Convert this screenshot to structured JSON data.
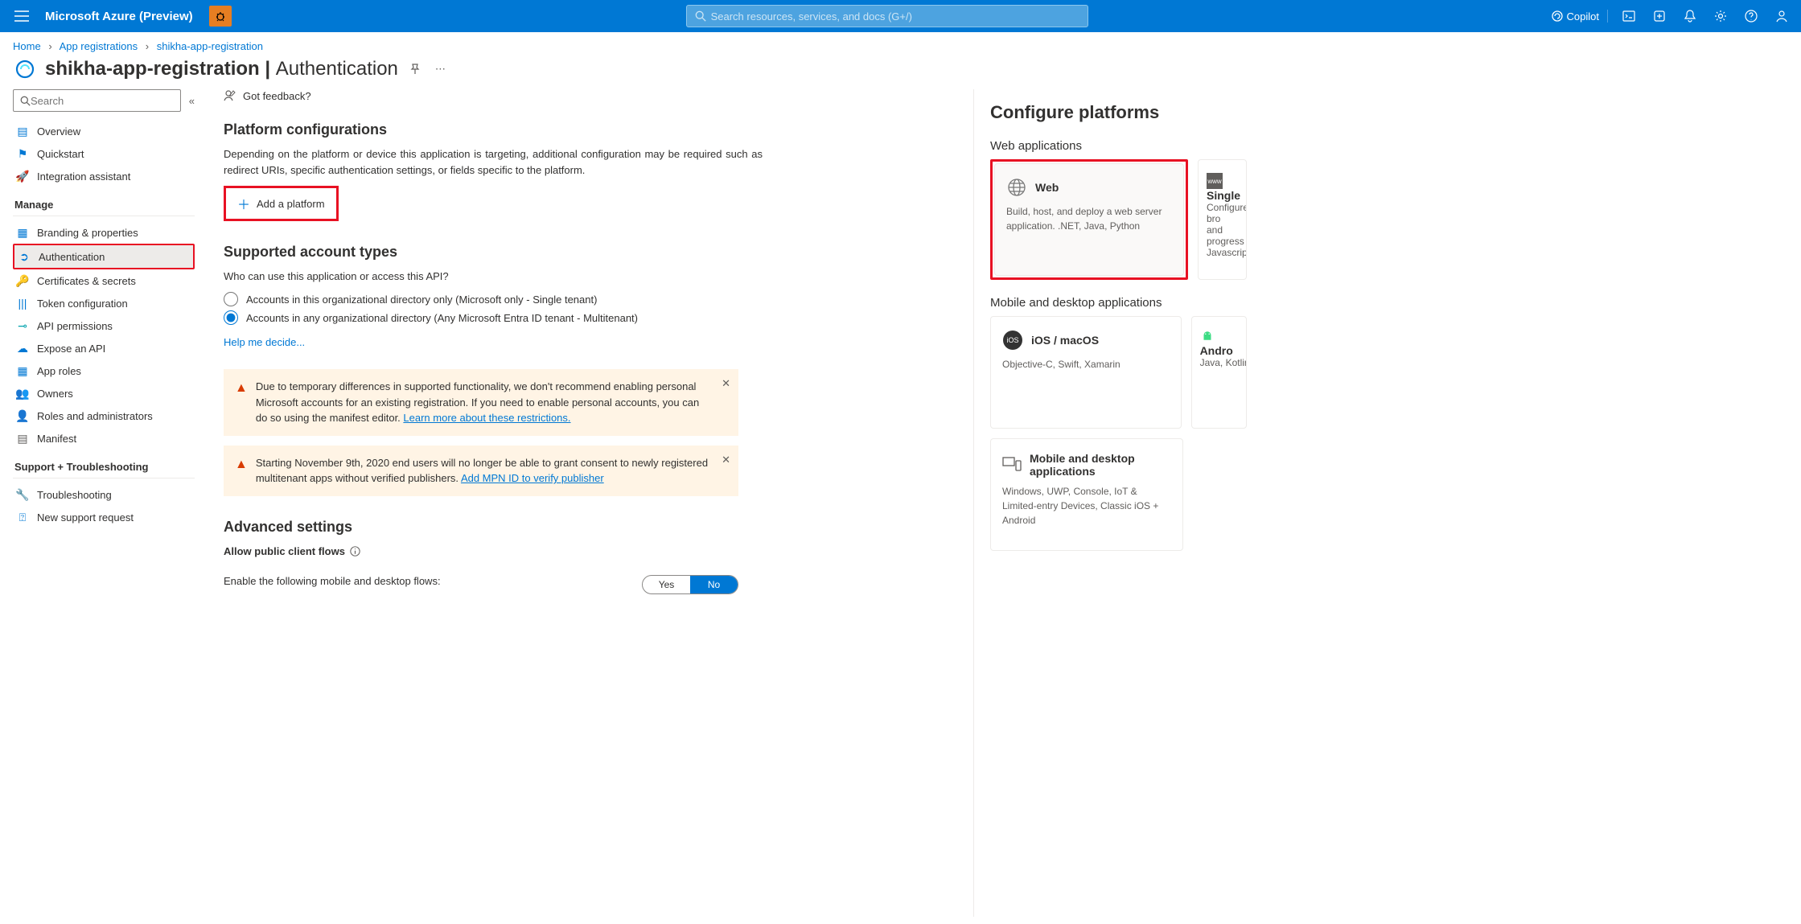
{
  "topbar": {
    "brand": "Microsoft Azure (Preview)",
    "search_placeholder": "Search resources, services, and docs (G+/)",
    "copilot_label": "Copilot"
  },
  "breadcrumb": {
    "items": [
      "Home",
      "App registrations",
      "shikha-app-registration"
    ]
  },
  "page": {
    "title_app": "shikha-app-registration",
    "title_sep": " | ",
    "title_section": "Authentication"
  },
  "sidebar": {
    "search_placeholder": "Search",
    "items": [
      {
        "label": "Overview",
        "icon": "≡",
        "color": "#0078d4"
      },
      {
        "label": "Quickstart",
        "icon": "☁",
        "color": "#0078d4"
      },
      {
        "label": "Integration assistant",
        "icon": "🚀",
        "color": "#d83b01"
      }
    ],
    "manage_label": "Manage",
    "manage_items": [
      {
        "label": "Branding & properties",
        "icon": "▦",
        "color": "#0078d4"
      },
      {
        "label": "Authentication",
        "icon": "➲",
        "color": "#0078d4",
        "selected": true
      },
      {
        "label": "Certificates & secrets",
        "icon": "🔑",
        "color": "#e6b800"
      },
      {
        "label": "Token configuration",
        "icon": "|||",
        "color": "#0078d4"
      },
      {
        "label": "API permissions",
        "icon": "⊸",
        "color": "#00a2ad"
      },
      {
        "label": "Expose an API",
        "icon": "☁",
        "color": "#0078d4"
      },
      {
        "label": "App roles",
        "icon": "▦",
        "color": "#0078d4"
      },
      {
        "label": "Owners",
        "icon": "👥",
        "color": "#0078d4"
      },
      {
        "label": "Roles and administrators",
        "icon": "👤",
        "color": "#107c10"
      },
      {
        "label": "Manifest",
        "icon": "▤",
        "color": "#605e5c"
      }
    ],
    "support_label": "Support + Troubleshooting",
    "support_items": [
      {
        "label": "Troubleshooting",
        "icon": "🔧",
        "color": "#605e5c"
      },
      {
        "label": "New support request",
        "icon": "⍰",
        "color": "#0078d4"
      }
    ]
  },
  "main": {
    "feedback_label": "Got feedback?",
    "platform_heading": "Platform configurations",
    "platform_desc": "Depending on the platform or device this application is targeting, additional configuration may be required such as redirect URIs, specific authentication settings, or fields specific to the platform.",
    "add_platform_label": "Add a platform",
    "supported_heading": "Supported account types",
    "supported_question": "Who can use this application or access this API?",
    "radio1": "Accounts in this organizational directory only (Microsoft only - Single tenant)",
    "radio2": "Accounts in any organizational directory (Any Microsoft Entra ID tenant - Multitenant)",
    "help_decide": "Help me decide...",
    "alert1_text": "Due to temporary differences in supported functionality, we don't recommend enabling personal Microsoft accounts for an existing registration. If you need to enable personal accounts, you can do so using the manifest editor. ",
    "alert1_link": "Learn more about these restrictions.",
    "alert2_text": "Starting November 9th, 2020 end users will no longer be able to grant consent to newly registered multitenant apps without verified publishers. ",
    "alert2_link": "Add MPN ID to verify publisher",
    "advanced_heading": "Advanced settings",
    "allow_public_label": "Allow public client flows",
    "enable_flows_text": "Enable the following mobile and desktop flows:",
    "toggle_yes": "Yes",
    "toggle_no": "No"
  },
  "panel": {
    "heading": "Configure platforms",
    "web_group": "Web applications",
    "mobile_group": "Mobile and desktop applications",
    "cards": {
      "web": {
        "title": "Web",
        "desc": "Build, host, and deploy a web server application. .NET, Java, Python"
      },
      "spa": {
        "title": "Single",
        "desc": "Configure bro\nand progress\nJavascript."
      },
      "ios": {
        "title": "iOS / macOS",
        "desc": "Objective-C, Swift, Xamarin"
      },
      "android": {
        "title": "Andro",
        "desc": "Java, Kotlin, X"
      },
      "desktop": {
        "title": "Mobile and desktop applications",
        "desc": "Windows, UWP, Console, IoT & Limited-entry Devices, Classic iOS + Android"
      }
    }
  }
}
